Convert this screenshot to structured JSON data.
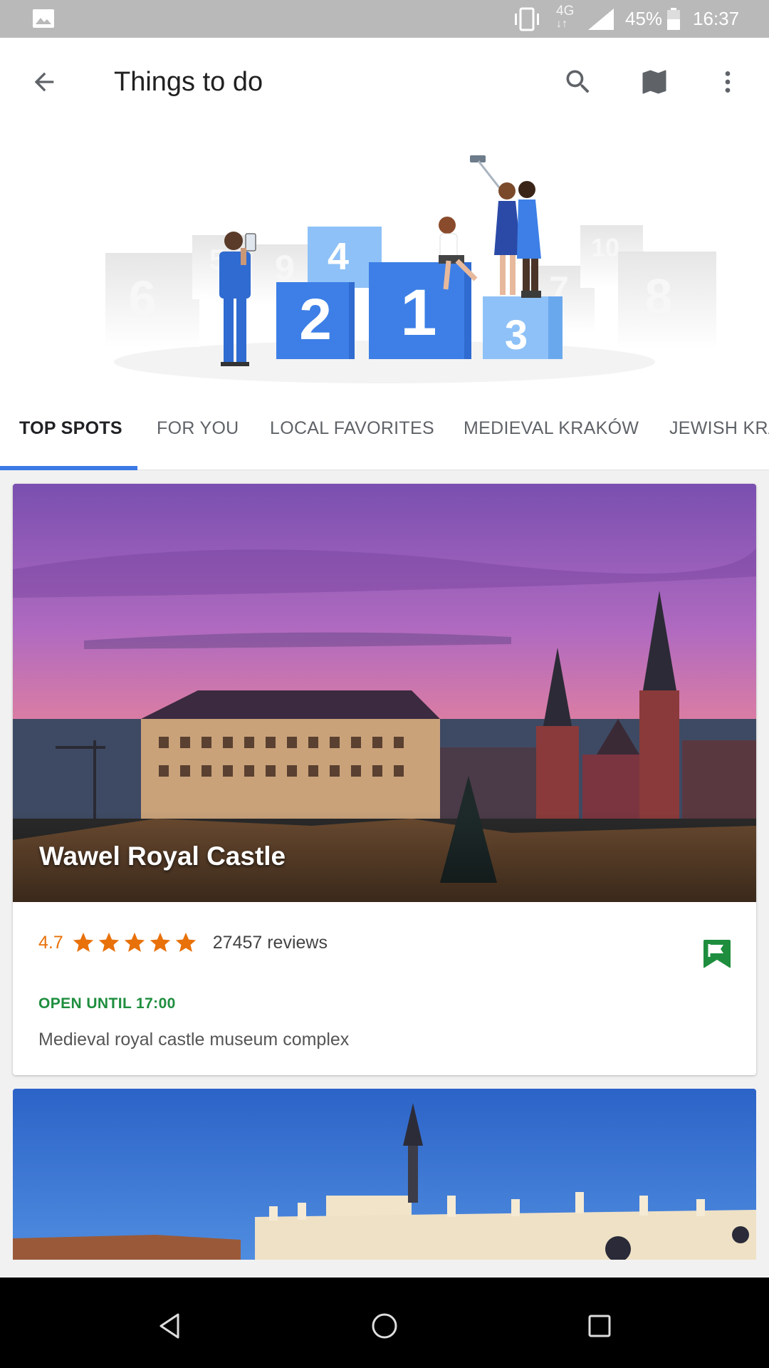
{
  "status_bar": {
    "network": "4G",
    "battery_percent": "45%",
    "time": "16:37"
  },
  "app_bar": {
    "title": "Things to do",
    "icons": [
      "back-arrow-icon",
      "search-icon",
      "map-icon",
      "more-vert-icon"
    ]
  },
  "hero": {
    "podium_numbers": [
      "2",
      "1",
      "3",
      "4"
    ],
    "background_numbers": [
      "6",
      "5",
      "9",
      "7",
      "10",
      "8"
    ]
  },
  "tabs": {
    "items": [
      {
        "label": "TOP SPOTS",
        "active": true
      },
      {
        "label": "FOR YOU",
        "active": false
      },
      {
        "label": "LOCAL FAVORITES",
        "active": false
      },
      {
        "label": "MEDIEVAL KRAKÓW",
        "active": false
      },
      {
        "label": "JEWISH KRA",
        "active": false
      }
    ]
  },
  "cards": [
    {
      "title": "Wawel Royal Castle",
      "rating": "4.7",
      "stars": 5,
      "reviews": "27457 reviews",
      "status": "OPEN UNTIL 17:00",
      "description": "Medieval royal castle museum complex",
      "saved": true
    }
  ],
  "colors": {
    "accent": "#3b79e4",
    "star": "#e8710a",
    "open": "#1e8e3e",
    "flag": "#1e8e3e"
  },
  "nav_bar": {
    "icons": [
      "nav-back-icon",
      "nav-home-icon",
      "nav-recents-icon"
    ]
  }
}
